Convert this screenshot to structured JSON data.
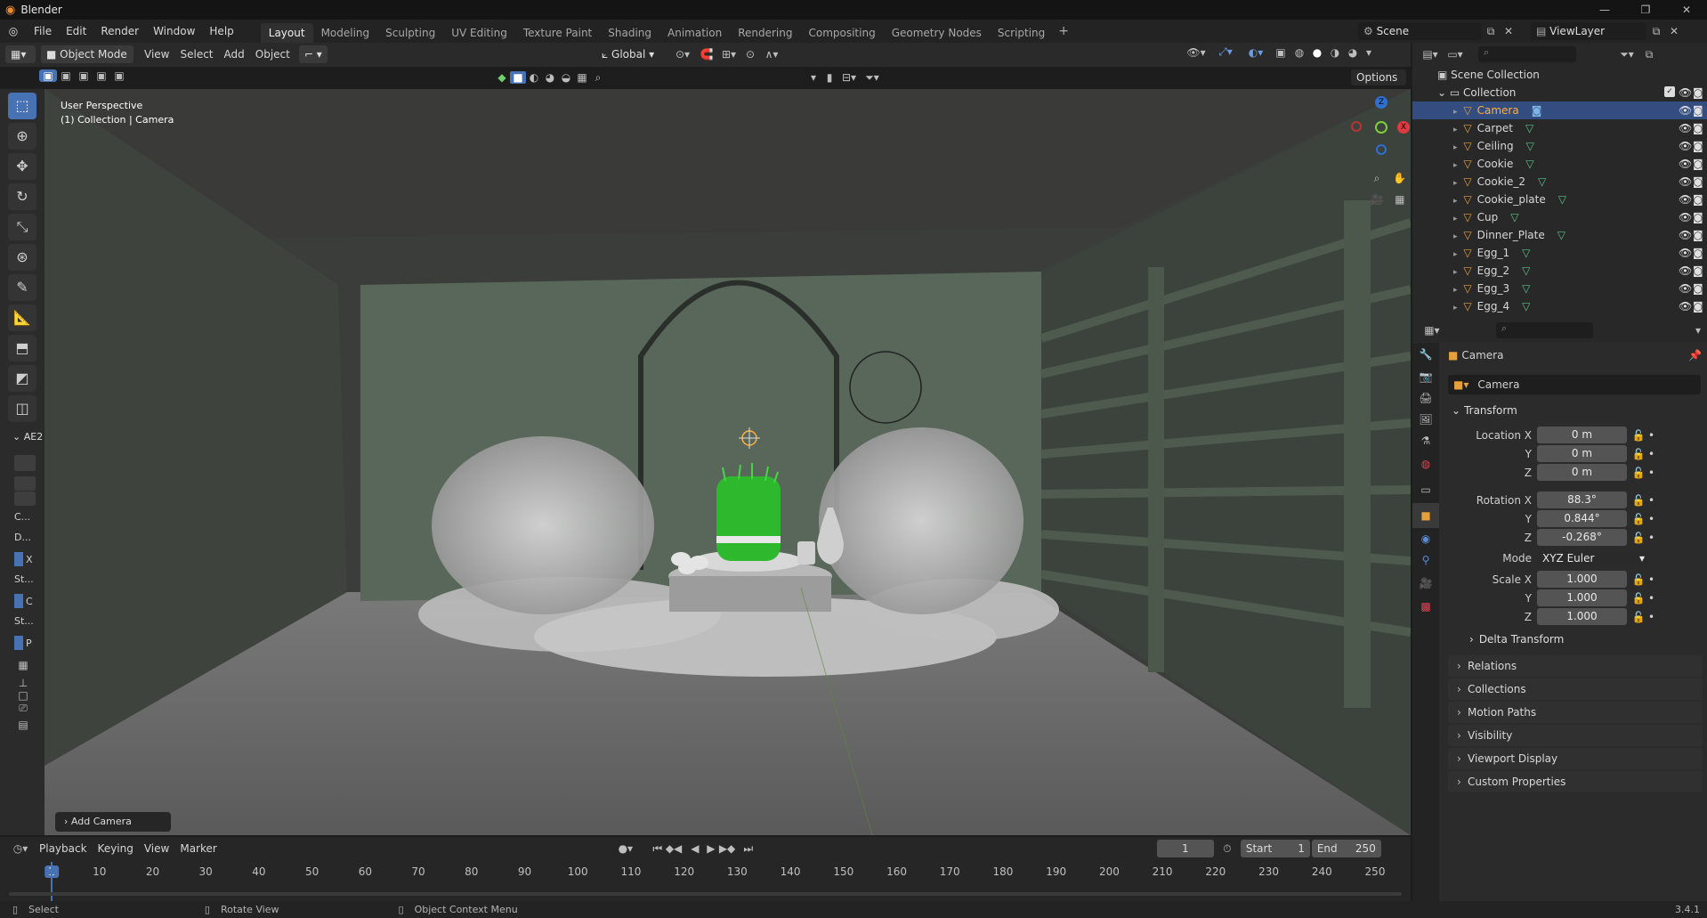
{
  "title_bar": {
    "app_name": "Blender"
  },
  "menu": {
    "items": [
      "File",
      "Edit",
      "Render",
      "Window",
      "Help"
    ],
    "workspaces": [
      "Layout",
      "Modeling",
      "Sculpting",
      "UV Editing",
      "Texture Paint",
      "Shading",
      "Animation",
      "Rendering",
      "Compositing",
      "Geometry Nodes",
      "Scripting"
    ],
    "add_workspace": "+",
    "scene_name": "Scene",
    "view_layer": "ViewLayer"
  },
  "viewport_header": {
    "mode": "Object Mode",
    "menus": [
      "View",
      "Select",
      "Add",
      "Object"
    ],
    "orientation": "Global",
    "options": "Options"
  },
  "viewport": {
    "perspective_label": "User Perspective",
    "collection_label": "(1) Collection | Camera",
    "operator_panel": "Add Camera",
    "gizmo_axes": {
      "x": "X",
      "y": "Y",
      "z": "Z"
    }
  },
  "toolbar_panel": {
    "category": "AE2",
    "labels": [
      "C...",
      "D...",
      "St...",
      "St..."
    ],
    "checks": [
      "X",
      "C",
      "P"
    ]
  },
  "outliner": {
    "root": "Scene Collection",
    "collection": "Collection",
    "objects": [
      "Camera",
      "Carpet",
      "Ceiling",
      "Cookie",
      "Cookie_2",
      "Cookie_plate",
      "Cup",
      "Dinner_Plate",
      "Egg_1",
      "Egg_2",
      "Egg_3",
      "Egg_4"
    ],
    "selected": "Camera"
  },
  "properties": {
    "object_name": "Camera",
    "data_name": "Camera",
    "transform_title": "Transform",
    "location_label": "Location X",
    "rotation_label": "Rotation X",
    "scale_label": "Scale X",
    "y_label": "Y",
    "z_label": "Z",
    "location": [
      "0 m",
      "0 m",
      "0 m"
    ],
    "rotation": [
      "88.3°",
      "0.844°",
      "-0.268°"
    ],
    "mode_label": "Mode",
    "mode_value": "XYZ Euler",
    "scale": [
      "1.000",
      "1.000",
      "1.000"
    ],
    "delta": "Delta Transform",
    "panels": [
      "Relations",
      "Collections",
      "Motion Paths",
      "Visibility",
      "Viewport Display",
      "Custom Properties"
    ]
  },
  "timeline": {
    "menus": [
      "Playback",
      "Keying",
      "View",
      "Marker"
    ],
    "current_frame": "1",
    "start_label": "Start",
    "start": "1",
    "end_label": "End",
    "end": "250",
    "ticks": [
      "1",
      "10",
      "20",
      "30",
      "40",
      "50",
      "60",
      "70",
      "80",
      "90",
      "100",
      "110",
      "120",
      "130",
      "140",
      "150",
      "160",
      "170",
      "180",
      "190",
      "200",
      "210",
      "220",
      "230",
      "240",
      "250"
    ]
  },
  "status": {
    "select": "Select",
    "rotate": "Rotate View",
    "context": "Object Context Menu",
    "version": "3.4.1"
  },
  "colors": {
    "accent": "#4772b3",
    "grass": "#2db82d",
    "selected_row": "#334d80"
  }
}
